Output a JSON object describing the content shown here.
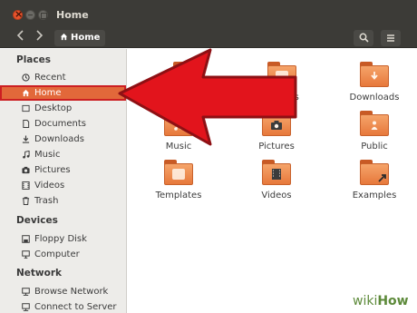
{
  "window": {
    "title": "Home"
  },
  "toolbar": {
    "back_icon": "chevron-left-icon",
    "forward_icon": "chevron-right-icon",
    "breadcrumb": "Home",
    "search_icon": "search-icon",
    "menu_icon": "hamburger-menu-icon"
  },
  "sidebar": {
    "places_title": "Places",
    "items": [
      {
        "label": "Recent",
        "icon": "clock-icon"
      },
      {
        "label": "Home",
        "icon": "home-icon",
        "active": true
      },
      {
        "label": "Desktop",
        "icon": "desktop-icon"
      },
      {
        "label": "Documents",
        "icon": "document-icon"
      },
      {
        "label": "Downloads",
        "icon": "download-icon"
      },
      {
        "label": "Music",
        "icon": "music-icon"
      },
      {
        "label": "Pictures",
        "icon": "camera-icon"
      },
      {
        "label": "Videos",
        "icon": "film-icon"
      },
      {
        "label": "Trash",
        "icon": "trash-icon"
      }
    ],
    "devices_title": "Devices",
    "devices": [
      {
        "label": "Floppy Disk",
        "icon": "floppy-icon"
      },
      {
        "label": "Computer",
        "icon": "computer-icon"
      }
    ],
    "network_title": "Network",
    "network": [
      {
        "label": "Browse Network",
        "icon": "network-icon"
      },
      {
        "label": "Connect to Server",
        "icon": "server-icon"
      }
    ]
  },
  "main": {
    "folders": [
      {
        "label": "",
        "icon": "desktop-folder-icon"
      },
      {
        "label": "uments",
        "icon": "documents-folder-icon"
      },
      {
        "label": "Downloads",
        "icon": "downloads-folder-icon"
      },
      {
        "label": "Music",
        "icon": "music-folder-icon"
      },
      {
        "label": "Pictures",
        "icon": "pictures-folder-icon"
      },
      {
        "label": "Public",
        "icon": "public-folder-icon"
      },
      {
        "label": "Templates",
        "icon": "templates-folder-icon"
      },
      {
        "label": "Videos",
        "icon": "videos-folder-icon"
      },
      {
        "label": "Examples",
        "icon": "examples-folder-icon"
      }
    ]
  },
  "annotation": {
    "arrow_color": "#e2141c",
    "active_color": "#e2683a"
  },
  "watermark": {
    "part1": "wiki",
    "part2": "How"
  }
}
